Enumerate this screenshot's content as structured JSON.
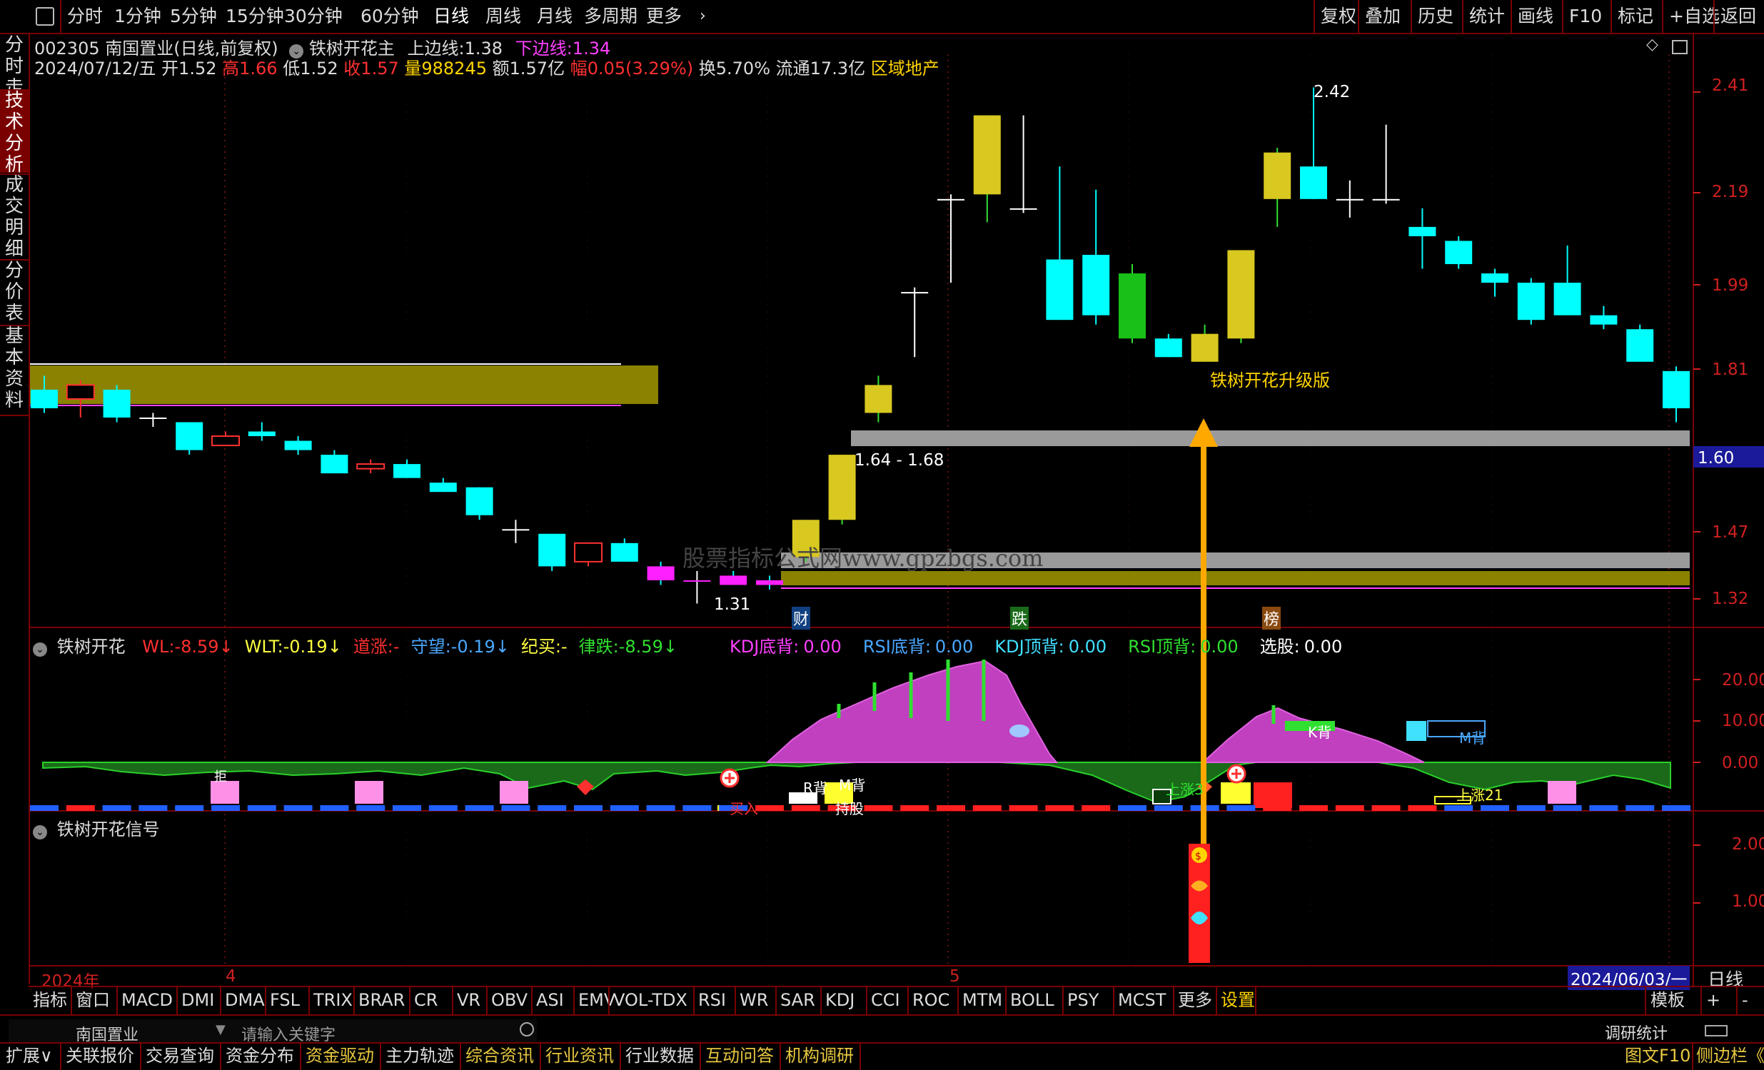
{
  "topmenu": {
    "periods": [
      "分时",
      "1分钟",
      "5分钟",
      "15分钟",
      "30分钟",
      "60分钟",
      "日线",
      "周线",
      "月线",
      "多周期",
      "更多"
    ],
    "right": [
      "复权",
      "叠加",
      "历史",
      "统计",
      "画线",
      "F10",
      "标记",
      "+自选",
      "返回"
    ]
  },
  "lefttabs": [
    "分时走势",
    "技术分析",
    "成交明细",
    "分价表",
    "基本资料"
  ],
  "stock": {
    "code_name": "002305 南国置业(日线,前复权)",
    "indicator": "铁树开花主",
    "upper_label": "上边线:",
    "upper_val": "1.38",
    "lower_label": "下边线:",
    "lower_val": "1.34",
    "date": "2024/07/12/五",
    "open": "开1.52",
    "high": "高1.66",
    "low": "低1.52",
    "close": "收1.57",
    "volume": "量988245",
    "amount": "额1.57亿",
    "change": "幅0.05(3.29%)",
    "turnover": "换5.70%",
    "float": "流通17.3亿",
    "sector": "区域地产"
  },
  "main_axis": [
    "2.41",
    "2.19",
    "1.99",
    "1.81",
    "1.60",
    "1.47",
    "1.32"
  ],
  "main_labels": {
    "high_mark": "2.42",
    "low_mark": "1.31",
    "range": "1.64 - 1.68",
    "signal": "铁树开花升级版",
    "watermark": "股票指标公式网www.gpzbgs.com",
    "tag1": "财",
    "tag2": "跌",
    "tag3": "榜"
  },
  "sub1": {
    "title": "铁树开花",
    "items": [
      {
        "label": "WL:",
        "value": "-8.59↓",
        "color": "#ff3030"
      },
      {
        "label": "WLT:",
        "value": "-0.19↓",
        "color": "#ffff40"
      },
      {
        "label": "道涨:",
        "value": "-",
        "color": "#ff3030"
      },
      {
        "label": "守望:",
        "value": "-0.19↓",
        "color": "#4aa8ff"
      },
      {
        "label": "纪买:",
        "value": "-",
        "color": "#ffff40"
      },
      {
        "label": "律跌:",
        "value": "-8.59↓",
        "color": "#30e030"
      }
    ],
    "items2": [
      {
        "label": "KDJ底背:",
        "value": "0.00",
        "color": "#ff40ff"
      },
      {
        "label": "RSI底背:",
        "value": "0.00",
        "color": "#4aa8ff"
      },
      {
        "label": "KDJ顶背:",
        "value": "0.00",
        "color": "#40e0ff"
      },
      {
        "label": "RSI顶背:",
        "value": "0.00",
        "color": "#30e030"
      },
      {
        "label": "选股:",
        "value": "0.00",
        "color": "#ffffff"
      }
    ],
    "axis": [
      "20.00",
      "10.00",
      "0.00"
    ],
    "marks": [
      "R背",
      "M背",
      "K背",
      "M背",
      "上涨3",
      "上涨21",
      "持股",
      "买入",
      "拒"
    ]
  },
  "sub2": {
    "title": "铁树开花信号",
    "axis": [
      "2.00",
      "1.00"
    ]
  },
  "timeaxis": {
    "year": "2024年",
    "m4": "4",
    "m5": "5",
    "cursor": "2024/06/03/一",
    "period": "日线"
  },
  "bottomtabs": [
    "指标",
    "窗口",
    "MACD",
    "DMI",
    "DMA",
    "FSL",
    "TRIX",
    "BRAR",
    "CR",
    "VR",
    "OBV",
    "ASI",
    "EMV",
    "VOL-TDX",
    "RSI",
    "WR",
    "SAR",
    "KDJ",
    "CCI",
    "ROC",
    "MTM",
    "BOLL",
    "PSY",
    "MCST",
    "更多",
    "设置"
  ],
  "bottomright": [
    "模板",
    "+",
    "-"
  ],
  "searchbar": {
    "stock": "南国置业",
    "placeholder": "请输入关键字",
    "right": "调研统计"
  },
  "bottom2": [
    {
      "label": "扩展∨",
      "color": "#dddddd"
    },
    {
      "label": "关联报价",
      "color": "#dddddd"
    },
    {
      "label": "交易查询",
      "color": "#dddddd"
    },
    {
      "label": "资金分布",
      "color": "#dddddd"
    },
    {
      "label": "资金驱动",
      "color": "#e8c840"
    },
    {
      "label": "主力轨迹",
      "color": "#dddddd"
    },
    {
      "label": "综合资讯",
      "color": "#e8c840"
    },
    {
      "label": "行业资讯",
      "color": "#e8c840"
    },
    {
      "label": "行业数据",
      "color": "#dddddd"
    },
    {
      "label": "互动问答",
      "color": "#e8c840"
    },
    {
      "label": "机构调研",
      "color": "#e8c840"
    }
  ],
  "bottom2right": [
    "图文F10",
    "侧边栏《"
  ],
  "candles": [
    {
      "o": 1.77,
      "c": 1.73,
      "h": 1.8,
      "l": 1.72
    },
    {
      "o": 1.75,
      "c": 1.78,
      "h": 1.79,
      "l": 1.71
    },
    {
      "o": 1.77,
      "c": 1.71,
      "h": 1.78,
      "l": 1.7
    },
    {
      "o": 1.71,
      "c": 1.71,
      "h": 1.72,
      "l": 1.69
    },
    {
      "o": 1.7,
      "c": 1.64,
      "h": 1.7,
      "l": 1.63
    },
    {
      "o": 1.65,
      "c": 1.67,
      "h": 1.68,
      "l": 1.65
    },
    {
      "o": 1.68,
      "c": 1.67,
      "h": 1.7,
      "l": 1.66
    },
    {
      "o": 1.66,
      "c": 1.64,
      "h": 1.67,
      "l": 1.63
    },
    {
      "o": 1.63,
      "c": 1.59,
      "h": 1.64,
      "l": 1.59
    },
    {
      "o": 1.6,
      "c": 1.61,
      "h": 1.62,
      "l": 1.59
    },
    {
      "o": 1.61,
      "c": 1.58,
      "h": 1.62,
      "l": 1.58
    },
    {
      "o": 1.57,
      "c": 1.55,
      "h": 1.58,
      "l": 1.55
    },
    {
      "o": 1.56,
      "c": 1.5,
      "h": 1.56,
      "l": 1.49
    },
    {
      "o": 1.47,
      "c": 1.47,
      "h": 1.49,
      "l": 1.44
    },
    {
      "o": 1.46,
      "c": 1.39,
      "h": 1.46,
      "l": 1.38
    },
    {
      "o": 1.4,
      "c": 1.44,
      "h": 1.44,
      "l": 1.39
    },
    {
      "o": 1.44,
      "c": 1.4,
      "h": 1.45,
      "l": 1.4
    },
    {
      "o": 1.39,
      "c": 1.36,
      "h": 1.4,
      "l": 1.35
    },
    {
      "o": 1.36,
      "c": 1.36,
      "h": 1.38,
      "l": 1.31
    },
    {
      "o": 1.37,
      "c": 1.35,
      "h": 1.38,
      "l": 1.35
    },
    {
      "o": 1.36,
      "c": 1.35,
      "h": 1.37,
      "l": 1.34
    },
    {
      "o": 1.41,
      "c": 1.49,
      "h": 1.49,
      "l": 1.4
    },
    {
      "o": 1.49,
      "c": 1.63,
      "h": 1.63,
      "l": 1.48
    },
    {
      "o": 1.72,
      "c": 1.78,
      "h": 1.8,
      "l": 1.7
    },
    {
      "o": 1.98,
      "c": 1.98,
      "h": 1.99,
      "l": 1.84
    },
    {
      "o": 2.18,
      "c": 2.18,
      "h": 2.19,
      "l": 2.0
    },
    {
      "o": 2.19,
      "c": 2.36,
      "h": 2.36,
      "l": 2.13
    },
    {
      "o": 2.16,
      "c": 2.16,
      "h": 2.36,
      "l": 2.15
    },
    {
      "o": 2.05,
      "c": 1.92,
      "h": 2.25,
      "l": 1.92
    },
    {
      "o": 2.06,
      "c": 1.93,
      "h": 2.2,
      "l": 1.91
    },
    {
      "o": 1.88,
      "c": 2.02,
      "h": 2.04,
      "l": 1.87
    },
    {
      "o": 1.88,
      "c": 1.84,
      "h": 1.89,
      "l": 1.84
    },
    {
      "o": 1.83,
      "c": 1.89,
      "h": 1.91,
      "l": 1.83
    },
    {
      "o": 1.88,
      "c": 2.07,
      "h": 2.07,
      "l": 1.87
    },
    {
      "o": 2.18,
      "c": 2.28,
      "h": 2.29,
      "l": 2.12
    },
    {
      "o": 2.25,
      "c": 2.18,
      "h": 2.42,
      "l": 2.18
    },
    {
      "o": 2.18,
      "c": 2.18,
      "h": 2.22,
      "l": 2.14
    },
    {
      "o": 2.18,
      "c": 2.18,
      "h": 2.34,
      "l": 2.17
    },
    {
      "o": 2.12,
      "c": 2.1,
      "h": 2.16,
      "l": 2.03
    },
    {
      "o": 2.09,
      "c": 2.04,
      "h": 2.1,
      "l": 2.03
    },
    {
      "o": 2.02,
      "c": 2.0,
      "h": 2.03,
      "l": 1.97
    },
    {
      "o": 2.0,
      "c": 1.92,
      "h": 2.01,
      "l": 1.91
    },
    {
      "o": 2.0,
      "c": 1.93,
      "h": 2.08,
      "l": 1.93
    },
    {
      "o": 1.93,
      "c": 1.91,
      "h": 1.95,
      "l": 1.9
    },
    {
      "o": 1.9,
      "c": 1.83,
      "h": 1.91,
      "l": 1.83
    },
    {
      "o": 1.81,
      "c": 1.73,
      "h": 1.82,
      "l": 1.7
    }
  ]
}
